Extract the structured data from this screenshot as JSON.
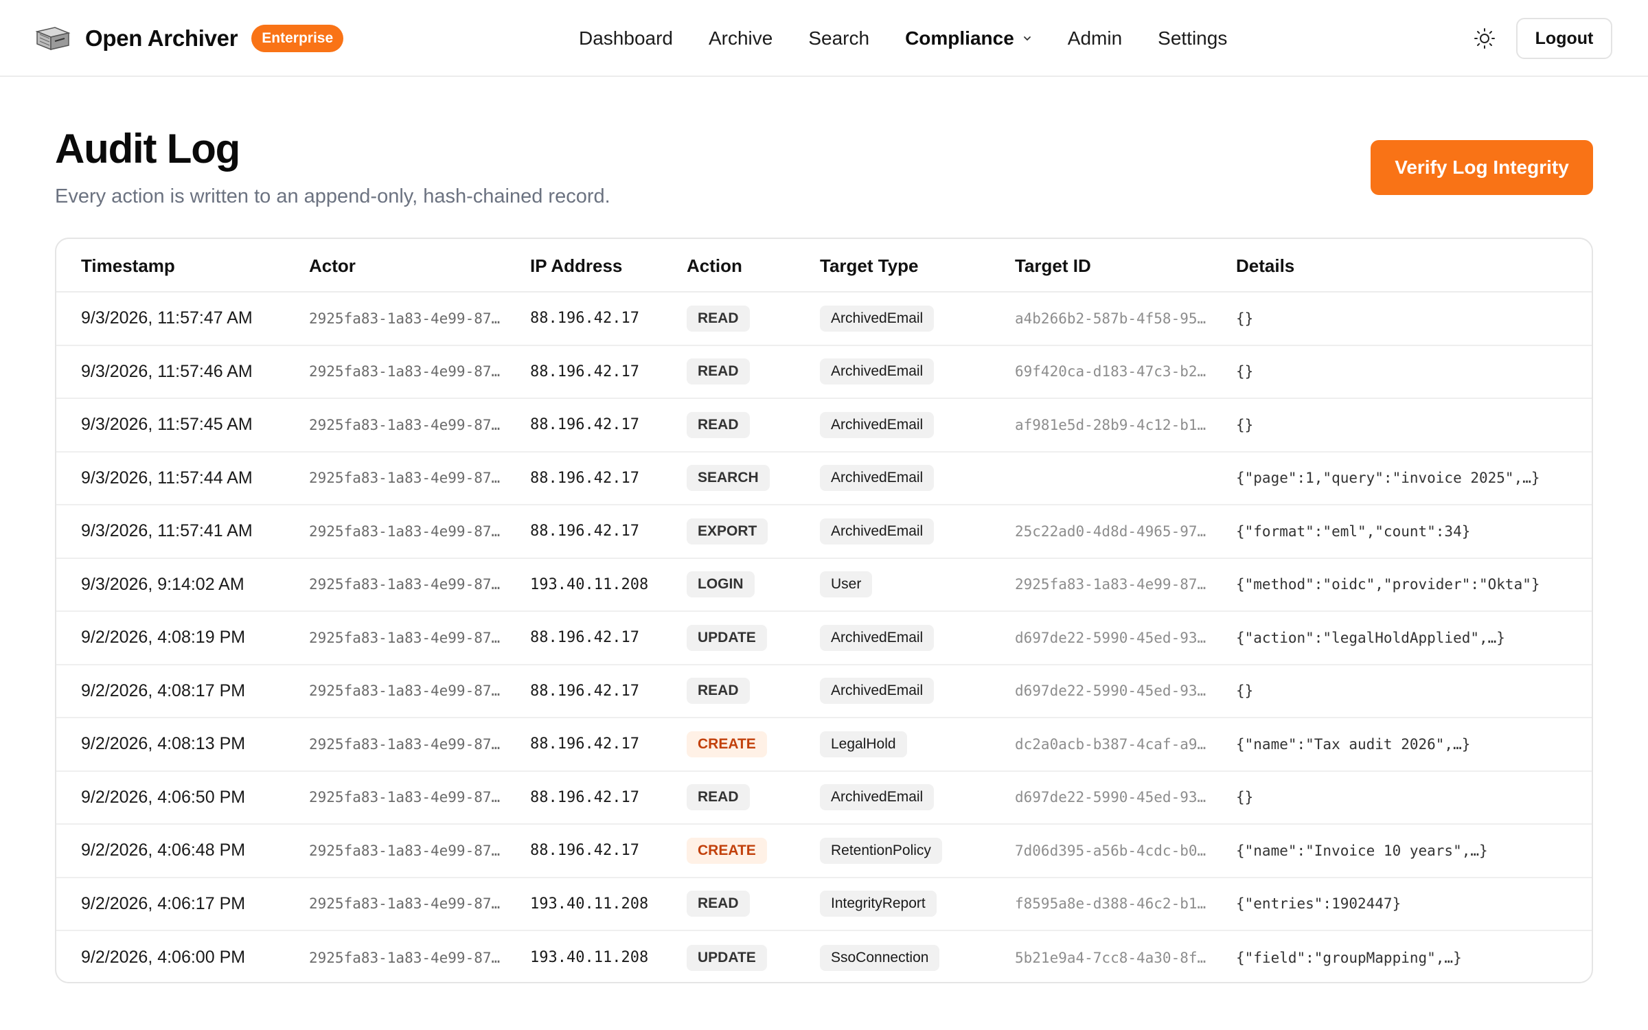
{
  "app": {
    "name": "Open Archiver",
    "edition_badge": "Enterprise"
  },
  "nav": {
    "dashboard": "Dashboard",
    "archive": "Archive",
    "search": "Search",
    "compliance": "Compliance",
    "admin": "Admin",
    "settings": "Settings"
  },
  "header": {
    "logout": "Logout",
    "theme_icon": "sun-icon"
  },
  "page": {
    "title": "Audit Log",
    "subtitle": "Every action is written to an append-only, hash-chained record.",
    "verify_button": "Verify Log Integrity"
  },
  "colors": {
    "accent": "#f97316",
    "create_text": "#c2410c",
    "create_bg": "#fff1e6",
    "pill_bg": "#f1f1f1"
  },
  "table": {
    "headers": {
      "timestamp": "Timestamp",
      "actor": "Actor",
      "ip": "IP Address",
      "action": "Action",
      "target_type": "Target Type",
      "target_id": "Target ID",
      "details": "Details"
    },
    "rows": [
      {
        "timestamp": "9/3/2026, 11:57:47 AM",
        "actor": "2925fa83-1a83-4e99-87…",
        "ip": "88.196.42.17",
        "action": "READ",
        "target_type": "ArchivedEmail",
        "target_id": "a4b266b2-587b-4f58-95…",
        "details": "{}"
      },
      {
        "timestamp": "9/3/2026, 11:57:46 AM",
        "actor": "2925fa83-1a83-4e99-87…",
        "ip": "88.196.42.17",
        "action": "READ",
        "target_type": "ArchivedEmail",
        "target_id": "69f420ca-d183-47c3-b2…",
        "details": "{}"
      },
      {
        "timestamp": "9/3/2026, 11:57:45 AM",
        "actor": "2925fa83-1a83-4e99-87…",
        "ip": "88.196.42.17",
        "action": "READ",
        "target_type": "ArchivedEmail",
        "target_id": "af981e5d-28b9-4c12-b1…",
        "details": "{}"
      },
      {
        "timestamp": "9/3/2026, 11:57:44 AM",
        "actor": "2925fa83-1a83-4e99-87…",
        "ip": "88.196.42.17",
        "action": "SEARCH",
        "target_type": "ArchivedEmail",
        "target_id": "",
        "details": "{\"page\":1,\"query\":\"invoice 2025\",…}"
      },
      {
        "timestamp": "9/3/2026, 11:57:41 AM",
        "actor": "2925fa83-1a83-4e99-87…",
        "ip": "88.196.42.17",
        "action": "EXPORT",
        "target_type": "ArchivedEmail",
        "target_id": "25c22ad0-4d8d-4965-97…",
        "details": "{\"format\":\"eml\",\"count\":34}"
      },
      {
        "timestamp": "9/3/2026, 9:14:02 AM",
        "actor": "2925fa83-1a83-4e99-87…",
        "ip": "193.40.11.208",
        "action": "LOGIN",
        "target_type": "User",
        "target_id": "2925fa83-1a83-4e99-87…",
        "details": "{\"method\":\"oidc\",\"provider\":\"Okta\"}"
      },
      {
        "timestamp": "9/2/2026, 4:08:19 PM",
        "actor": "2925fa83-1a83-4e99-87…",
        "ip": "88.196.42.17",
        "action": "UPDATE",
        "target_type": "ArchivedEmail",
        "target_id": "d697de22-5990-45ed-93…",
        "details": "{\"action\":\"legalHoldApplied\",…}"
      },
      {
        "timestamp": "9/2/2026, 4:08:17 PM",
        "actor": "2925fa83-1a83-4e99-87…",
        "ip": "88.196.42.17",
        "action": "READ",
        "target_type": "ArchivedEmail",
        "target_id": "d697de22-5990-45ed-93…",
        "details": "{}"
      },
      {
        "timestamp": "9/2/2026, 4:08:13 PM",
        "actor": "2925fa83-1a83-4e99-87…",
        "ip": "88.196.42.17",
        "action": "CREATE",
        "target_type": "LegalHold",
        "target_id": "dc2a0acb-b387-4caf-a9…",
        "details": "{\"name\":\"Tax audit 2026\",…}"
      },
      {
        "timestamp": "9/2/2026, 4:06:50 PM",
        "actor": "2925fa83-1a83-4e99-87…",
        "ip": "88.196.42.17",
        "action": "READ",
        "target_type": "ArchivedEmail",
        "target_id": "d697de22-5990-45ed-93…",
        "details": "{}"
      },
      {
        "timestamp": "9/2/2026, 4:06:48 PM",
        "actor": "2925fa83-1a83-4e99-87…",
        "ip": "88.196.42.17",
        "action": "CREATE",
        "target_type": "RetentionPolicy",
        "target_id": "7d06d395-a56b-4cdc-b0…",
        "details": "{\"name\":\"Invoice 10 years\",…}"
      },
      {
        "timestamp": "9/2/2026, 4:06:17 PM",
        "actor": "2925fa83-1a83-4e99-87…",
        "ip": "193.40.11.208",
        "action": "READ",
        "target_type": "IntegrityReport",
        "target_id": "f8595a8e-d388-46c2-b1…",
        "details": "{\"entries\":1902447}"
      },
      {
        "timestamp": "9/2/2026, 4:06:00 PM",
        "actor": "2925fa83-1a83-4e99-87…",
        "ip": "193.40.11.208",
        "action": "UPDATE",
        "target_type": "SsoConnection",
        "target_id": "5b21e9a4-7cc8-4a30-8f…",
        "details": "{\"field\":\"groupMapping\",…}"
      }
    ]
  }
}
